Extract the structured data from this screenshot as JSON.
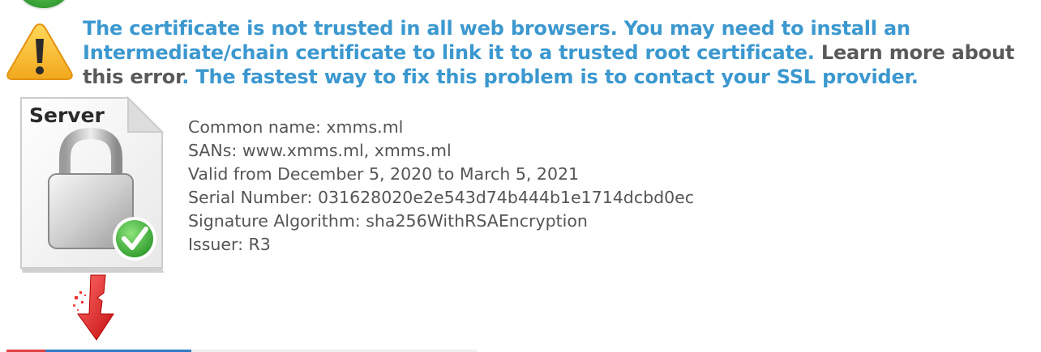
{
  "warning": {
    "text_part1": "The certificate is not trusted in all web browsers. You may need to install an Intermediate/chain certificate to link it to a trusted root certificate.",
    "learn_more_link": "Learn more about this error",
    "text_part2": ". The fastest way to fix this problem is to contact your SSL provider.",
    "icon": "warning-triangle-icon"
  },
  "server_icon": {
    "label": "Server",
    "icon": "server-lock-check-icon"
  },
  "certificate": {
    "common_name_label": "Common name:",
    "common_name_value": "xmms.ml",
    "sans_label": "SANs:",
    "sans_value": "www.xmms.ml, xmms.ml",
    "valid_text": "Valid from December 5, 2020 to March 5, 2021",
    "serial_label": "Serial Number:",
    "serial_value": "031628020e2e543d74b444b1e1714dcbd0ec",
    "signature_label": "Signature Algorithm:",
    "signature_value": "sha256WithRSAEncryption",
    "issuer_label": "Issuer:",
    "issuer_value": "R3"
  },
  "colors": {
    "link_blue": "#3c98cf",
    "text_gray": "#555555",
    "warning_orange": "#f2a81d",
    "check_green": "#4caf3a",
    "broken_arrow_red": "#e22222"
  },
  "chain_icon": "broken-chain-arrow-icon"
}
